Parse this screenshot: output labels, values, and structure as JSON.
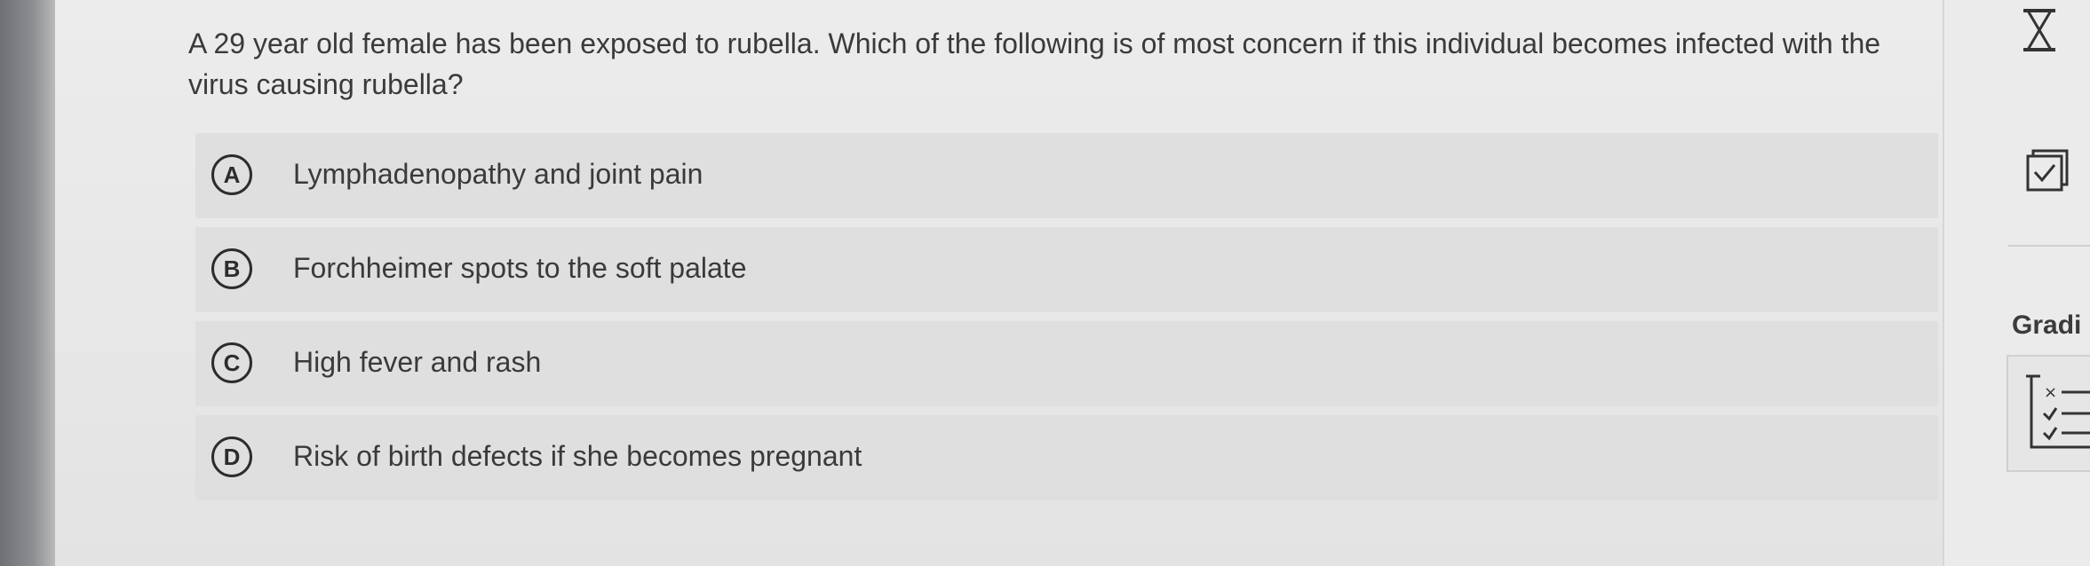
{
  "question": {
    "text": "A 29 year old female has been exposed to rubella. Which of the following is of most concern if this individual becomes infected with the virus causing rubella?"
  },
  "options": [
    {
      "letter": "A",
      "text": "Lymphadenopathy and joint pain"
    },
    {
      "letter": "B",
      "text": "Forchheimer spots to the soft palate"
    },
    {
      "letter": "C",
      "text": "High fever and rash"
    },
    {
      "letter": "D",
      "text": "Risk of birth defects if she becomes pregnant"
    }
  ],
  "side_panel": {
    "grading_label": "Gradi",
    "icons": [
      "hourglass-icon",
      "checkbox-icon",
      "grading-checklist-icon"
    ]
  },
  "colors": {
    "background": "#e9eaea",
    "option_background": "#dfdfdf",
    "text": "#3a3a3a"
  }
}
